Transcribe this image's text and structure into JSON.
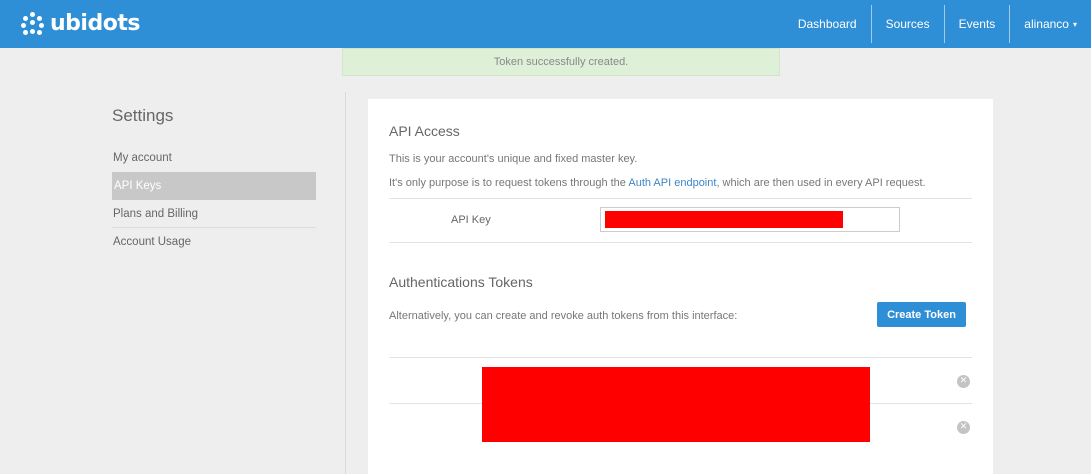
{
  "app": {
    "logo_text": "ubidots"
  },
  "nav": {
    "items": [
      {
        "label": "Dashboard"
      },
      {
        "label": "Sources"
      },
      {
        "label": "Events"
      },
      {
        "label": "alinanco"
      }
    ],
    "caret": "▾"
  },
  "toast": {
    "message": "Token successfully created."
  },
  "sidebar": {
    "title": "Settings",
    "items": [
      {
        "label": "My account",
        "active": false
      },
      {
        "label": "API Keys",
        "active": true
      },
      {
        "label": "Plans and Billing",
        "active": false
      },
      {
        "label": "Account Usage",
        "active": false
      }
    ]
  },
  "api_access": {
    "title": "API Access",
    "line1": "This is your account's unique and fixed master key.",
    "line2_prefix": "It's only purpose is to request tokens through the ",
    "line2_link": "Auth API endpoint",
    "line2_suffix": ", which are then used in every API request.",
    "key_label": "API Key",
    "copy_icon": "copy-icon"
  },
  "auth_tokens": {
    "title": "Authentications Tokens",
    "description": "Alternatively, you can create and revoke auth tokens from this interface:",
    "create_button": "Create Token",
    "revoke_icon": "revoke-icon",
    "revoke_glyph": "✕"
  },
  "colors": {
    "topbar": "#2e8fd6",
    "accent": "#2e8fd6",
    "success_bg": "#dff0d8",
    "redaction": "#ff0000",
    "active_sidebar": "#c8c8c8"
  }
}
